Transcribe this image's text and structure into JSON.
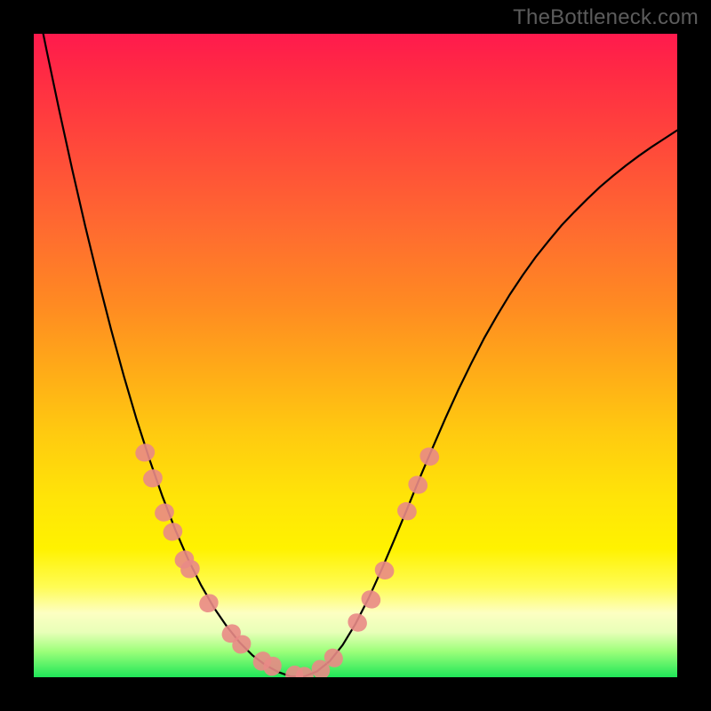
{
  "attribution": "TheBottleneck.com",
  "colors": {
    "frame": "#000000",
    "curve": "#000000",
    "markerFill": "#e98a86",
    "gradientStops": [
      "#ff1a4d",
      "#ff4a3a",
      "#ff8a22",
      "#ffca10",
      "#fff200",
      "#fdffc2",
      "#1fe658"
    ]
  },
  "chart_data": {
    "type": "line",
    "title": "",
    "xlabel": "",
    "ylabel": "",
    "x": [
      0.0,
      0.02,
      0.04,
      0.06,
      0.08,
      0.1,
      0.12,
      0.14,
      0.16,
      0.18,
      0.2,
      0.22,
      0.24,
      0.26,
      0.28,
      0.3,
      0.32,
      0.34,
      0.36,
      0.38,
      0.4,
      0.42,
      0.44,
      0.46,
      0.48,
      0.5,
      0.52,
      0.54,
      0.56,
      0.58,
      0.6,
      0.62,
      0.64,
      0.66,
      0.68,
      0.7,
      0.72,
      0.74,
      0.76,
      0.78,
      0.8,
      0.82,
      0.84,
      0.86,
      0.88,
      0.9,
      0.92,
      0.94,
      0.96,
      0.98,
      1.0
    ],
    "values": [
      1.072,
      0.974,
      0.879,
      0.788,
      0.701,
      0.619,
      0.541,
      0.468,
      0.4,
      0.338,
      0.281,
      0.229,
      0.183,
      0.143,
      0.108,
      0.079,
      0.054,
      0.034,
      0.019,
      0.008,
      0.001,
      0.001,
      0.009,
      0.025,
      0.05,
      0.083,
      0.122,
      0.166,
      0.213,
      0.261,
      0.31,
      0.357,
      0.403,
      0.447,
      0.488,
      0.527,
      0.562,
      0.595,
      0.625,
      0.653,
      0.678,
      0.702,
      0.723,
      0.743,
      0.762,
      0.779,
      0.795,
      0.81,
      0.824,
      0.837,
      0.85
    ],
    "xlim": [
      0,
      1
    ],
    "ylim": [
      0,
      1
    ],
    "markers": [
      {
        "x": 0.173,
        "y": 0.349
      },
      {
        "x": 0.185,
        "y": 0.309
      },
      {
        "x": 0.203,
        "y": 0.256
      },
      {
        "x": 0.216,
        "y": 0.226
      },
      {
        "x": 0.234,
        "y": 0.183
      },
      {
        "x": 0.243,
        "y": 0.168
      },
      {
        "x": 0.272,
        "y": 0.115
      },
      {
        "x": 0.307,
        "y": 0.068
      },
      {
        "x": 0.323,
        "y": 0.051
      },
      {
        "x": 0.355,
        "y": 0.025
      },
      {
        "x": 0.371,
        "y": 0.017
      },
      {
        "x": 0.405,
        "y": 0.003
      },
      {
        "x": 0.421,
        "y": 0.001
      },
      {
        "x": 0.446,
        "y": 0.012
      },
      {
        "x": 0.466,
        "y": 0.03
      },
      {
        "x": 0.503,
        "y": 0.085
      },
      {
        "x": 0.524,
        "y": 0.121
      },
      {
        "x": 0.545,
        "y": 0.166
      },
      {
        "x": 0.58,
        "y": 0.258
      },
      {
        "x": 0.597,
        "y": 0.299
      },
      {
        "x": 0.615,
        "y": 0.343
      }
    ],
    "grid": false,
    "legend": []
  }
}
